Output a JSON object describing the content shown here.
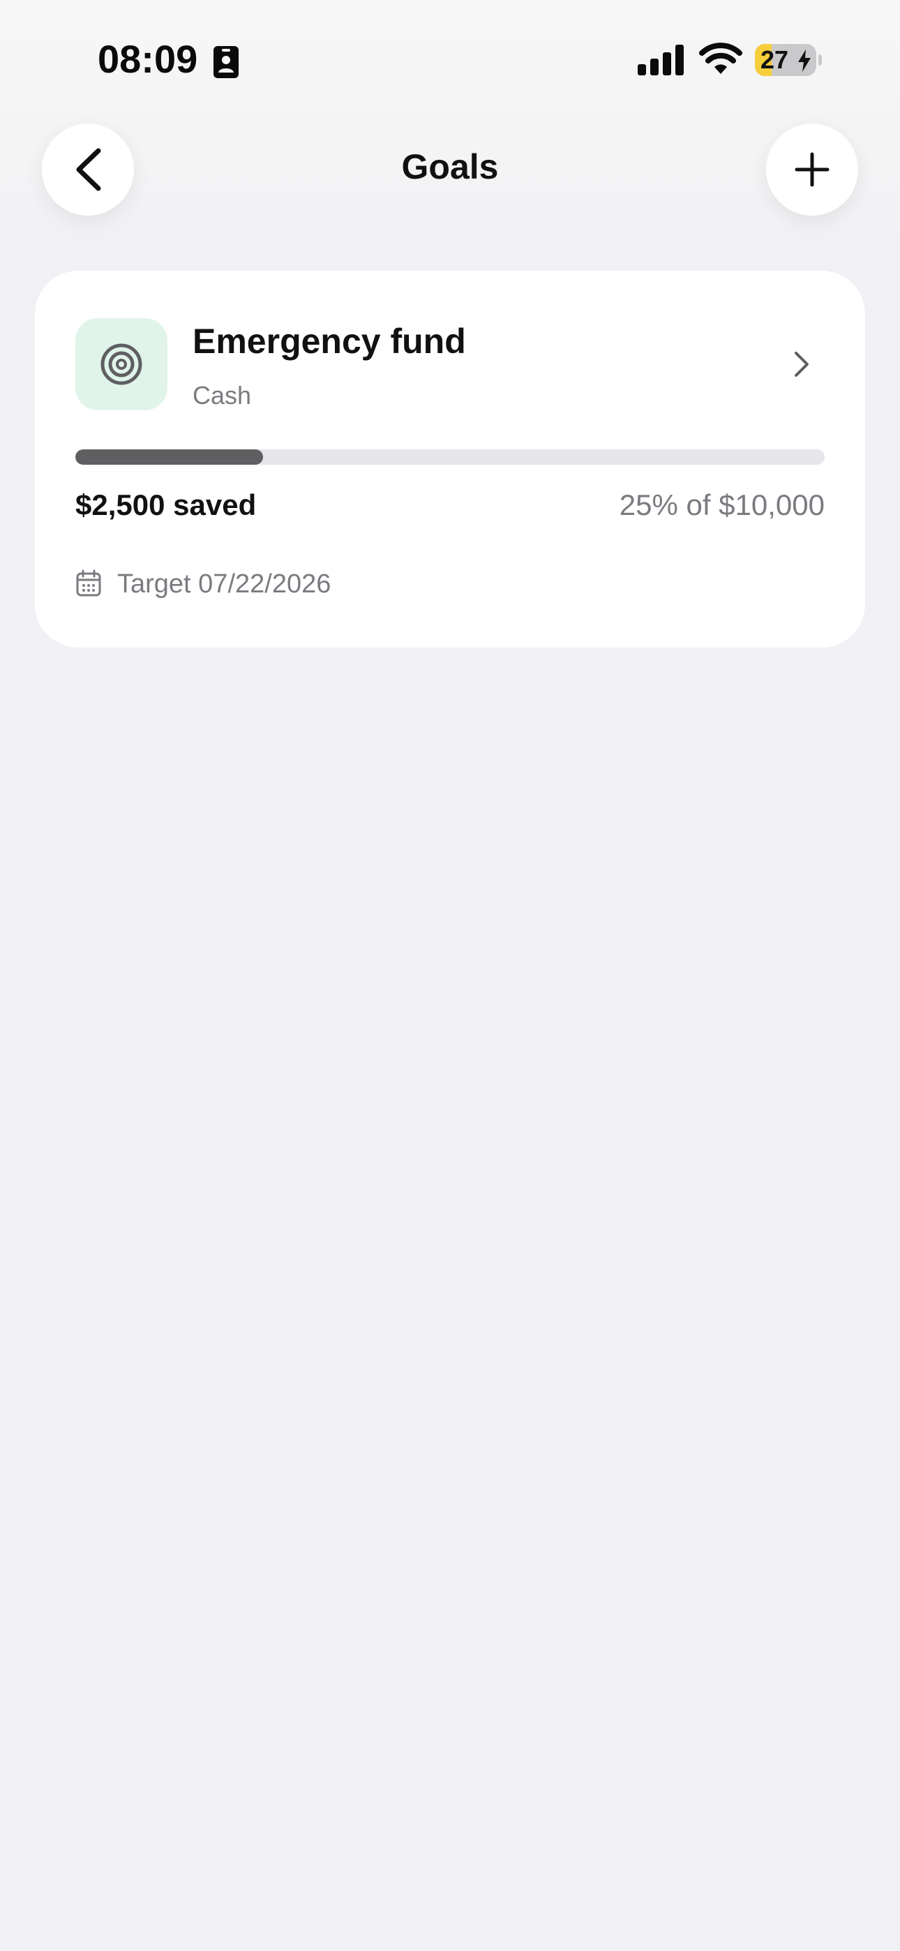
{
  "status_bar": {
    "time": "08:09",
    "battery_level": "27",
    "battery_fraction": 0.27,
    "icons": [
      "id-card-icon",
      "cellular-signal-icon",
      "wifi-icon",
      "battery-icon",
      "charging-bolt-icon"
    ]
  },
  "nav": {
    "title": "Goals",
    "back_icon": "chevron-left-icon",
    "add_icon": "plus-icon"
  },
  "goals": [
    {
      "name": "Emergency fund",
      "account": "Cash",
      "icon": "target-icon",
      "icon_bg": "#e1f4e9",
      "saved_label": "$2,500 saved",
      "progress_label": "25% of $10,000",
      "progress": 0.25,
      "target_label": "Target 07/22/2026",
      "target_icon": "calendar-icon",
      "chevron_icon": "chevron-right-icon"
    }
  ],
  "colors": {
    "background": "#f0f0f5",
    "card": "#ffffff",
    "progress_fill": "#5f5f62",
    "progress_track": "#e5e5ea",
    "battery_accent": "#f6cd3b",
    "secondary_text": "#7a7a80"
  }
}
